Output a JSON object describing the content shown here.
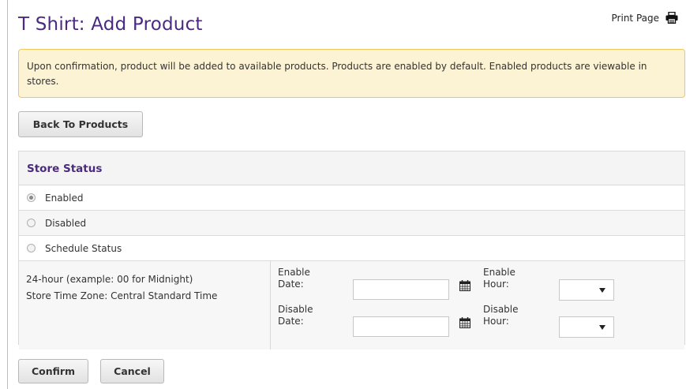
{
  "page": {
    "title": "T Shirt: Add Product",
    "print_label": "Print Page"
  },
  "icons": {
    "print": "printer-icon",
    "calendar": "calendar-icon",
    "dropdown": "chevron-down-icon"
  },
  "alert": {
    "message": "Upon confirmation, product will be added to available products. Products are enabled by default. Enabled products are viewable in stores."
  },
  "buttons": {
    "back": "Back To Products",
    "confirm": "Confirm",
    "cancel": "Cancel"
  },
  "store_status": {
    "heading": "Store Status",
    "options": [
      {
        "label": "Enabled",
        "selected": true
      },
      {
        "label": "Disabled",
        "selected": false
      },
      {
        "label": "Schedule Status",
        "selected": false
      }
    ]
  },
  "schedule": {
    "hint": "24-hour (example: 00 for Midnight)",
    "timezone": "Store Time Zone: Central Standard Time",
    "enable_date_label": [
      "Enable",
      "Date:"
    ],
    "disable_date_label": [
      "Disable",
      "Date:"
    ],
    "enable_hour_label": [
      "Enable",
      "Hour:"
    ],
    "disable_hour_label": [
      "Disable",
      "Hour:"
    ],
    "enable_date_value": "",
    "disable_date_value": "",
    "enable_hour_value": "",
    "disable_hour_value": ""
  },
  "colors": {
    "title": "#4b2a7f",
    "alert_bg": "#fcf2d4",
    "alert_border": "#f1c75c"
  }
}
